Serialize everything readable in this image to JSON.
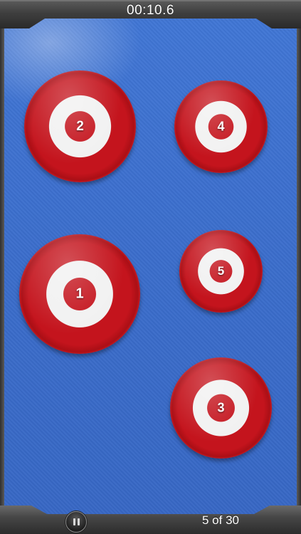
{
  "hud": {
    "timer": "00:10.6",
    "progress": "5 of 30"
  },
  "icons": {
    "pause": "pause-icon"
  },
  "targets": [
    {
      "label": "1"
    },
    {
      "label": "2"
    },
    {
      "label": "3"
    },
    {
      "label": "4"
    },
    {
      "label": "5"
    }
  ],
  "colors": {
    "background": "#3c6fcc",
    "target_red": "#c4141d",
    "target_white": "#f1f1f1",
    "bar": "#3f3f3f"
  }
}
